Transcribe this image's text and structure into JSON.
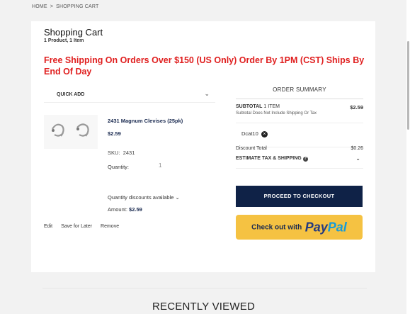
{
  "breadcrumb": {
    "home": "HOME",
    "separator": ">",
    "current": "SHOPPING CART"
  },
  "cart": {
    "title": "Shopping Cart",
    "subtitle": "1 Product, 1 Item",
    "promo": "Free Shipping On Orders Over $150 (US Only) Order By 1PM (CST) Ships By End Of Day",
    "quick_add": "QUICK ADD"
  },
  "item": {
    "name": "2431 Magnum Clevises (25pk)",
    "price": "$2.59",
    "sku_label": "SKU:",
    "sku": "2431",
    "quantity_label": "Quantity:",
    "quantity": "1",
    "discounts": "Quantity discounts available",
    "amount_label": "Amount:",
    "amount": "$2.59",
    "edit": "Edit",
    "save_for_later": "Save for Later",
    "remove": "Remove"
  },
  "summary": {
    "heading": "ORDER SUMMARY",
    "subtotal_label": "SUBTOTAL",
    "subtotal_items": "1 ITEM",
    "subtotal_value": "$2.59",
    "subtotal_note": "Subtotal Does Not Include Shipping Or Tax",
    "coupon_code": "Dcat10",
    "discount_label": "Discount Total",
    "discount_value": "$0.26",
    "estimate_label": "ESTIMATE TAX & SHIPPING",
    "checkout_label": "PROCEED TO CHECKOUT",
    "paypal_prefix": "Check out with",
    "paypal_pay": "Pay",
    "paypal_pal": "Pal"
  },
  "recent": {
    "heading": "RECENTLY VIEWED"
  },
  "icons": {
    "chevron": "chevron-down-icon",
    "remove_coupon": "close-circle-icon",
    "help": "help-circle-icon"
  },
  "colors": {
    "promo": "#e02020",
    "checkout_bg": "#0f2247",
    "paypal_bg": "#f5c242"
  }
}
